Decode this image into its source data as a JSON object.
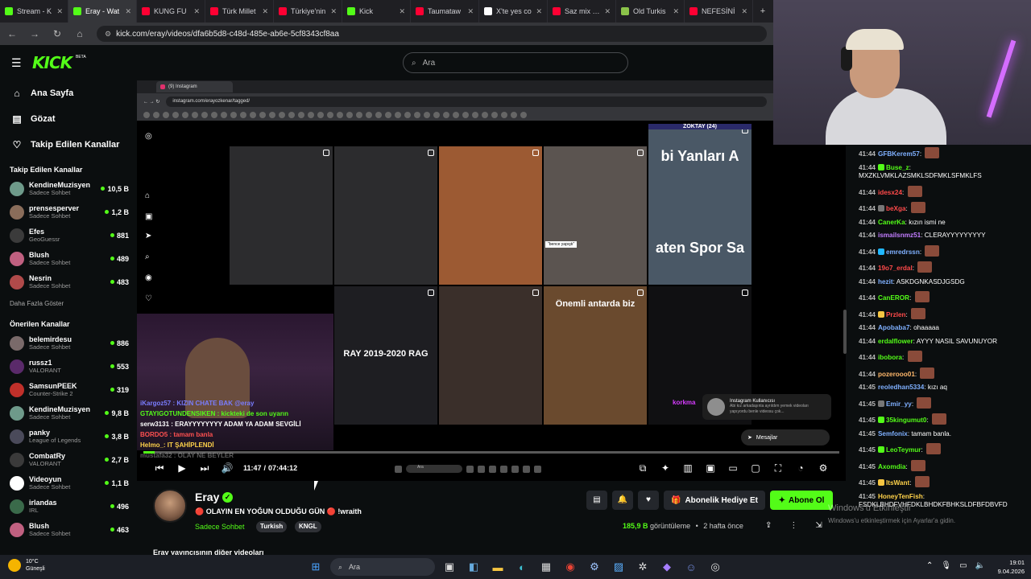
{
  "browser": {
    "tabs": [
      {
        "title": "Stream - K",
        "color": "#53fc18",
        "active": false
      },
      {
        "title": "Eray - Wat",
        "color": "#53fc18",
        "active": true
      },
      {
        "title": "KUNG FU",
        "color": "#ff0033",
        "active": false
      },
      {
        "title": "Türk Millet",
        "color": "#ff0033",
        "active": false
      },
      {
        "title": "Türkiye'nin",
        "color": "#ff0033",
        "active": false
      },
      {
        "title": "Kick",
        "color": "#53fc18",
        "active": false
      },
      {
        "title": "Taumataw",
        "color": "#ff0033",
        "active": false
      },
      {
        "title": "X'te yes co",
        "color": "#ffffff",
        "active": false
      },
      {
        "title": "Saz mix - Y",
        "color": "#ff0033",
        "active": false
      },
      {
        "title": "Old Turkis",
        "color": "#8bc34a",
        "active": false
      },
      {
        "title": "NEFESİNİ",
        "color": "#ff0033",
        "active": false
      }
    ],
    "url": "kick.com/eray/videos/dfa6b5d8-c48d-485e-ab6e-5cf8343cf8aa"
  },
  "header": {
    "logo": "KICK",
    "logo_badge": "BETA",
    "search_placeholder": "Ara"
  },
  "sidebar": {
    "nav": [
      {
        "label": "Ana Sayfa",
        "icon": "home-icon",
        "glyph": "⌂"
      },
      {
        "label": "Gözat",
        "icon": "browse-icon",
        "glyph": "▤"
      },
      {
        "label": "Takip Edilen Kanallar",
        "icon": "heart-icon",
        "glyph": "♡"
      }
    ],
    "followed_title": "Takip Edilen Kanallar",
    "followed": [
      {
        "name": "KendineMuzisyen",
        "category": "Sadece Sohbet",
        "viewers": "10,5 B",
        "color": "#6e9a8a"
      },
      {
        "name": "prensesperver",
        "category": "Sadece Sohbet",
        "viewers": "1,2 B",
        "color": "#8a6d5a"
      },
      {
        "name": "Efes",
        "category": "GeoGuessr",
        "viewers": "881",
        "color": "#3b3b3b"
      },
      {
        "name": "Blush",
        "category": "Sadece Sohbet",
        "viewers": "489",
        "color": "#c06080"
      },
      {
        "name": "Nesrin",
        "category": "Sadece Sohbet",
        "viewers": "483",
        "color": "#b04a4a"
      }
    ],
    "show_more": "Daha Fazla Göster",
    "recommended_title": "Önerilen Kanallar",
    "recommended": [
      {
        "name": "belemirdesu",
        "category": "Sadece Sohbet",
        "viewers": "886",
        "color": "#7a6a6a"
      },
      {
        "name": "russz1",
        "category": "VALORANT",
        "viewers": "553",
        "color": "#5a2a6a"
      },
      {
        "name": "SamsunPEEK",
        "category": "Counter-Strike 2",
        "viewers": "319",
        "color": "#c0302a"
      },
      {
        "name": "KendineMuzisyen",
        "category": "Sadece Sohbet",
        "viewers": "9,8 B",
        "color": "#6e9a8a"
      },
      {
        "name": "panky",
        "category": "League of Legends",
        "viewers": "3,8 B",
        "color": "#4a4a5a"
      },
      {
        "name": "CombatRy",
        "category": "VALORANT",
        "viewers": "2,7 B",
        "color": "#3a3a3a"
      },
      {
        "name": "Videoyun",
        "category": "Sadece Sohbet",
        "viewers": "1,1 B",
        "color": "#ffffff"
      },
      {
        "name": "irlandas",
        "category": "IRL",
        "viewers": "496",
        "color": "#3a6a4a"
      },
      {
        "name": "Blush",
        "category": "Sadece Sohbet",
        "viewers": "463",
        "color": "#c06080"
      }
    ]
  },
  "video": {
    "inner_tab_title": "(9) Instagram",
    "inner_url": "instagram.com/erayozkenar/tagged/",
    "tiles": [
      {
        "caption": "",
        "bg": "#2c2c2e"
      },
      {
        "caption": "",
        "bg": "#2c2c2e"
      },
      {
        "caption": "",
        "bg": "#9c5a33"
      },
      {
        "caption": "\"bence yapıştı\"",
        "bg": "#5b5450"
      },
      {
        "caption": "bi Yanları A",
        "subcaption": "aten Spor Sa",
        "top_label": "ZOKTAY (24)",
        "bg": "#4a5866"
      },
      {
        "caption": "RAY 2019-2020 RAG",
        "bg": "#1e1e22"
      },
      {
        "caption": "",
        "bg": "#3a2f2a"
      },
      {
        "caption": "Önemli antarda biz",
        "bg": "#6a4a2e"
      },
      {
        "caption": "korkma",
        "bg": "#101012"
      }
    ],
    "overlay_chat": [
      {
        "text": "iKargoz57 : KIZIN CHATE BAK @eray",
        "color": "#7a7dff",
        "dim": false
      },
      {
        "text": "GTAYIGOTUNDENSIKEN : kickteki de son uyarın",
        "color": "#53fc18",
        "dim": false
      },
      {
        "text": "serw3131 : ERAYYYYYYYY ADAM YA ADAM SEVGİLİ",
        "color": "#ffffff",
        "dim": false
      },
      {
        "text": "BORDO5 : tamam banla",
        "color": "#ff5050",
        "dim": false
      },
      {
        "text": "Helmo_: IT ŞAHİPLENDİ",
        "color": "#ffd24a",
        "dim": false
      },
      {
        "text": "mustafa32 : OLAY NE BEYLER",
        "color": "#aaaaaa",
        "dim": true
      }
    ],
    "notification_title": "Instagram Kullanıcısı",
    "notification_text": "Abi kız arkadaşınla ayrıldım yemek videoları yapıyordu benle videosu çok...",
    "messages_label": "Mesajlar",
    "progress": 0.016,
    "time_current": "11:47",
    "time_total": "07:44:12",
    "inner_search": "Ara"
  },
  "channel": {
    "name": "Eray",
    "title": "🔴 OLAYIN EN YOĞUN OLDUĞU GÜN 🔴 !wraith",
    "category": "Sadece Sohbet",
    "tags": [
      "Turkish",
      "KNGL"
    ],
    "gift_label": "Abonelik Hediye Et",
    "subscribe_label": "Abone Ol",
    "views": "185,9 B",
    "views_label": "görüntüleme",
    "age": "2 hafta önce",
    "other_videos": "Eray yayıncısının diğer videoları"
  },
  "chat": [
    {
      "time": "41:44",
      "user": "GFBKerem57",
      "text": "",
      "color": "#7fb0ff",
      "badge": "",
      "emote": true
    },
    {
      "time": "41:44",
      "user": "Buse_z",
      "text": "MXZKLVMKLAZSMKLSDFMKLSFMKLFS",
      "color": "#53fc18",
      "badge": "#53fc18",
      "emote": false
    },
    {
      "time": "41:44",
      "user": "idesx24",
      "text": "",
      "color": "#ff4a4a",
      "badge": "",
      "emote": true
    },
    {
      "time": "41:44",
      "user": "beXga",
      "text": "",
      "color": "#ff4a4a",
      "badge": "#777777",
      "emote": true
    },
    {
      "time": "41:44",
      "user": "CanerKa",
      "text": "kızın ismi ne",
      "color": "#53fc18",
      "badge": "",
      "emote": false
    },
    {
      "time": "41:44",
      "user": "ismailsnmz51",
      "text": "CLERAYYYYYYYYY",
      "color": "#c27dff",
      "badge": "",
      "emote": false
    },
    {
      "time": "41:44",
      "user": "emredrssn",
      "text": "",
      "color": "#7fb0ff",
      "badge": "#21b8ff",
      "emote": true
    },
    {
      "time": "41:44",
      "user": "19o7_erdal",
      "text": "",
      "color": "#ff4a4a",
      "badge": "",
      "emote": true
    },
    {
      "time": "41:44",
      "user": "hezit",
      "text": "ASKDGNKASDJGSDG",
      "color": "#7fb0ff",
      "badge": "",
      "emote": false
    },
    {
      "time": "41:44",
      "user": "CanEROR",
      "text": "",
      "color": "#53fc18",
      "badge": "",
      "emote": true
    },
    {
      "time": "41:44",
      "user": "Przlen",
      "text": "",
      "color": "#ff4a4a",
      "badge": "#f5c542",
      "emote": true
    },
    {
      "time": "41:44",
      "user": "Apobaba7",
      "text": "ohaaaaa",
      "color": "#7fb0ff",
      "badge": "",
      "emote": false
    },
    {
      "time": "41:44",
      "user": "erdalflower",
      "text": "AYYY NASIL SAVUNUYOR",
      "color": "#53fc18",
      "badge": "",
      "emote": false
    },
    {
      "time": "41:44",
      "user": "ibobora",
      "text": "",
      "color": "#53fc18",
      "badge": "",
      "emote": true
    },
    {
      "time": "41:44",
      "user": "pozerooo01",
      "text": "",
      "color": "#ffb86b",
      "badge": "",
      "emote": true
    },
    {
      "time": "41:45",
      "user": "reoledhan5334",
      "text": "kızı aq",
      "color": "#7fb0ff",
      "badge": "",
      "emote": false
    },
    {
      "time": "41:45",
      "user": "Emir_yy",
      "text": "",
      "color": "#7fb0ff",
      "badge": "#777777",
      "emote": true
    },
    {
      "time": "41:45",
      "user": "35kingumut0",
      "text": "",
      "color": "#53fc18",
      "badge": "#53fc18",
      "emote": true
    },
    {
      "time": "41:45",
      "user": "Semfonix",
      "text": "tamam banla.",
      "color": "#7fb0ff",
      "badge": "",
      "emote": false
    },
    {
      "time": "41:45",
      "user": "LeoTeymur",
      "text": "",
      "color": "#53fc18",
      "badge": "#53fc18",
      "emote": true
    },
    {
      "time": "41:45",
      "user": "Axomdia",
      "text": "",
      "color": "#53fc18",
      "badge": "",
      "emote": true
    },
    {
      "time": "41:45",
      "user": "ItsWant",
      "text": "",
      "color": "#ffd24a",
      "badge": "#f5c542",
      "emote": true
    },
    {
      "time": "41:45",
      "user": "HoneyTenFish",
      "text": "FSDKLBHDFVHFDKLBHDKFBHKSLDFBFDBVFD",
      "color": "#ffd24a",
      "badge": "",
      "emote": false
    }
  ],
  "windows_watermark": {
    "title": "Windows'u Etkinleştir",
    "subtitle": "Windows'u etkinleştirmek için Ayarlar'a gidin."
  },
  "taskbar": {
    "temp": "10°C",
    "weather": "Güneşli",
    "search": "Ara",
    "time": "19:01",
    "date": "9.04.2026"
  }
}
